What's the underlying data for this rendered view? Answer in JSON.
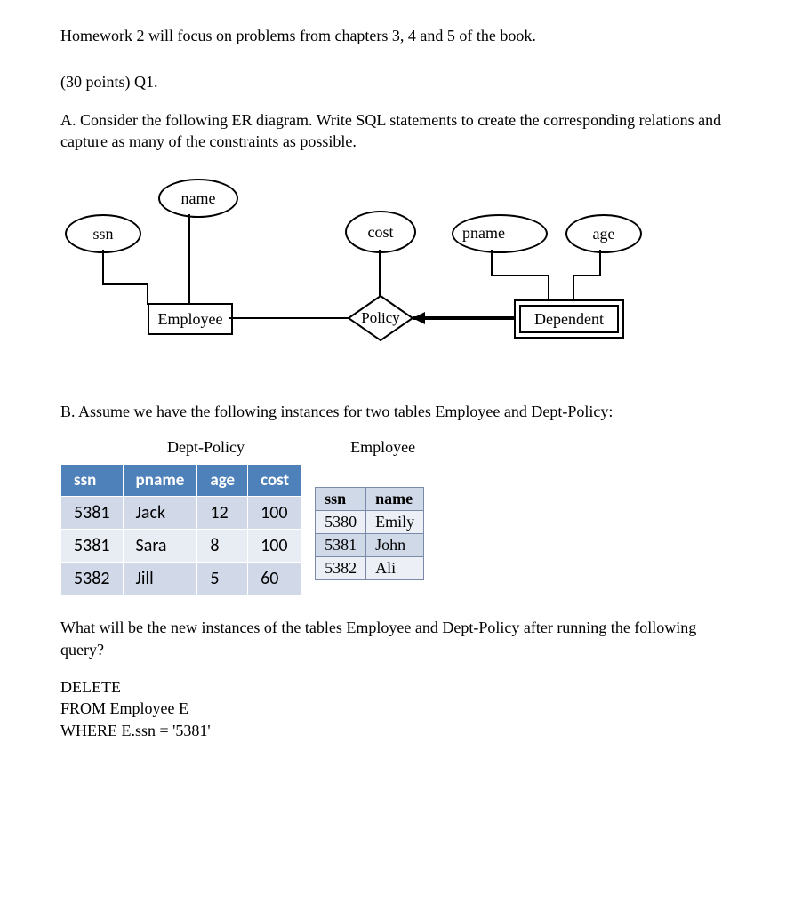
{
  "intro": "Homework 2 will focus on problems from chapters 3, 4 and 5 of the book.",
  "q1_header": "(30 points) Q1.",
  "partA": "A. Consider the following ER diagram. Write SQL statements to create the corresponding relations and capture as many of the constraints as possible.",
  "er": {
    "ssn": "ssn",
    "name": "name",
    "cost": "cost",
    "pname": "pname",
    "age": "age",
    "employee": "Employee",
    "policy": "Policy",
    "dependent": "Dependent"
  },
  "partB": "B. Assume we have the following instances for two tables Employee and Dept-Policy:",
  "dept_title": "Dept-Policy",
  "emp_title": "Employee",
  "dept_headers": [
    "ssn",
    "pname",
    "age",
    "cost"
  ],
  "dept_rows": [
    [
      "5381",
      "Jack",
      "12",
      "100"
    ],
    [
      "5381",
      "Sara",
      "8",
      "100"
    ],
    [
      "5382",
      "Jill",
      "5",
      "60"
    ]
  ],
  "emp_headers": [
    "ssn",
    "name"
  ],
  "emp_rows": [
    [
      "5380",
      "Emily"
    ],
    [
      "5381",
      "John"
    ],
    [
      "5382",
      "Ali"
    ]
  ],
  "question": "What will be the new instances of the tables Employee and Dept-Policy after running the following query?",
  "sql": {
    "l1": "DELETE",
    "l2": "FROM Employee  E",
    "l3": "WHERE E.ssn = '5381'"
  }
}
